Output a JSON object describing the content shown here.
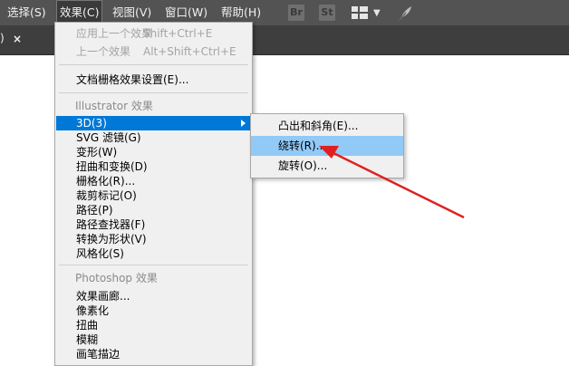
{
  "menubar": {
    "items": [
      {
        "label": "选择(S)"
      },
      {
        "label": "效果(C)"
      },
      {
        "label": "视图(V)"
      },
      {
        "label": "窗口(W)"
      },
      {
        "label": "帮助(H)"
      }
    ],
    "badge_br": "Br",
    "badge_st": "St",
    "icons": [
      "workspace-grid-icon",
      "chevron-down-icon",
      "feather-icon"
    ]
  },
  "tab": {
    "paren": ")",
    "close": "×"
  },
  "effect_menu": {
    "apply_last": {
      "label": "应用上一个效果",
      "shortcut": "Shift+Ctrl+E"
    },
    "last_effect": {
      "label": "上一个效果",
      "shortcut": "Alt+Shift+Ctrl+E"
    },
    "raster_settings": "文档栅格效果设置(E)...",
    "illustrator_header": "Illustrator 效果",
    "illustrator_items": [
      "3D(3)",
      "SVG 滤镜(G)",
      "变形(W)",
      "扭曲和变换(D)",
      "栅格化(R)...",
      "裁剪标记(O)",
      "路径(P)",
      "路径查找器(F)",
      "转换为形状(V)",
      "风格化(S)"
    ],
    "photoshop_header": "Photoshop 效果",
    "photoshop_items": [
      "效果画廊...",
      "像素化",
      "扭曲",
      "模糊",
      "画笔描边"
    ]
  },
  "submenu_3d": {
    "items": [
      "凸出和斜角(E)...",
      "绕转(R)...",
      "旋转(O)..."
    ]
  },
  "colors": {
    "menubar_bg": "#535353",
    "highlight": "#0078d7",
    "hover": "#91c9f7",
    "annotation_arrow": "#e02020"
  }
}
